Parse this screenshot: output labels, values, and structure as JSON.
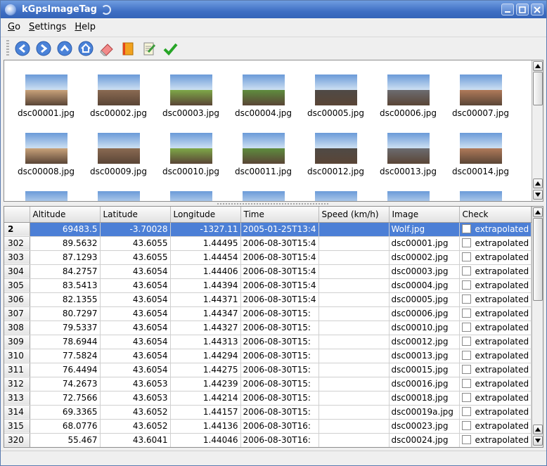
{
  "window": {
    "title": "kGpsImageTag",
    "colors": {
      "titlebar": "#3f6fc4",
      "selection": "#4c7fd6"
    }
  },
  "menu": [
    {
      "label": "Go"
    },
    {
      "label": "Settings"
    },
    {
      "label": "Help"
    }
  ],
  "toolbar": [
    {
      "icon": "back-arrow-icon"
    },
    {
      "icon": "forward-arrow-icon"
    },
    {
      "icon": "up-arrow-icon"
    },
    {
      "icon": "home-icon"
    },
    {
      "icon": "eraser-icon"
    },
    {
      "icon": "book-icon"
    },
    {
      "icon": "edit-document-icon"
    },
    {
      "icon": "checkmark-icon"
    }
  ],
  "thumbnails": [
    {
      "label": "dsc00001.jpg"
    },
    {
      "label": "dsc00002.jpg"
    },
    {
      "label": "dsc00003.jpg"
    },
    {
      "label": "dsc00004.jpg"
    },
    {
      "label": "dsc00005.jpg"
    },
    {
      "label": "dsc00006.jpg"
    },
    {
      "label": "dsc00007.jpg"
    },
    {
      "label": "dsc00008.jpg"
    },
    {
      "label": "dsc00009.jpg"
    },
    {
      "label": "dsc00010.jpg"
    },
    {
      "label": "dsc00011.jpg"
    },
    {
      "label": "dsc00012.jpg"
    },
    {
      "label": "dsc00013.jpg"
    },
    {
      "label": "dsc00014.jpg"
    }
  ],
  "table": {
    "columns": [
      "Altitude",
      "Latitude",
      "Longitude",
      "Time",
      "Speed (km/h)",
      "Image",
      "Check"
    ],
    "rows": [
      {
        "id": "2",
        "altitude": "69483.5",
        "latitude": "-3.70028",
        "longitude": "-1327.11",
        "time": "2005-01-25T13:4",
        "speed": "",
        "image": "Wolf.jpg",
        "check": "extrapolated",
        "selected": true
      },
      {
        "id": "302",
        "altitude": "89.5632",
        "latitude": "43.6055",
        "longitude": "1.44495",
        "time": "2006-08-30T15:4",
        "speed": "",
        "image": "dsc00001.jpg",
        "check": "extrapolated"
      },
      {
        "id": "303",
        "altitude": "87.1293",
        "latitude": "43.6055",
        "longitude": "1.44454",
        "time": "2006-08-30T15:4",
        "speed": "",
        "image": "dsc00002.jpg",
        "check": "extrapolated"
      },
      {
        "id": "304",
        "altitude": "84.2757",
        "latitude": "43.6054",
        "longitude": "1.44406",
        "time": "2006-08-30T15:4",
        "speed": "",
        "image": "dsc00003.jpg",
        "check": "extrapolated"
      },
      {
        "id": "305",
        "altitude": "83.5413",
        "latitude": "43.6054",
        "longitude": "1.44394",
        "time": "2006-08-30T15:4",
        "speed": "",
        "image": "dsc00004.jpg",
        "check": "extrapolated"
      },
      {
        "id": "306",
        "altitude": "82.1355",
        "latitude": "43.6054",
        "longitude": "1.44371",
        "time": "2006-08-30T15:4",
        "speed": "",
        "image": "dsc00005.jpg",
        "check": "extrapolated"
      },
      {
        "id": "307",
        "altitude": "80.7297",
        "latitude": "43.6054",
        "longitude": "1.44347",
        "time": "2006-08-30T15:",
        "speed": "",
        "image": "dsc00006.jpg",
        "check": "extrapolated"
      },
      {
        "id": "308",
        "altitude": "79.5337",
        "latitude": "43.6054",
        "longitude": "1.44327",
        "time": "2006-08-30T15:",
        "speed": "",
        "image": "dsc00010.jpg",
        "check": "extrapolated"
      },
      {
        "id": "309",
        "altitude": "78.6944",
        "latitude": "43.6054",
        "longitude": "1.44313",
        "time": "2006-08-30T15:",
        "speed": "",
        "image": "dsc00012.jpg",
        "check": "extrapolated"
      },
      {
        "id": "310",
        "altitude": "77.5824",
        "latitude": "43.6054",
        "longitude": "1.44294",
        "time": "2006-08-30T15:",
        "speed": "",
        "image": "dsc00013.jpg",
        "check": "extrapolated"
      },
      {
        "id": "311",
        "altitude": "76.4494",
        "latitude": "43.6054",
        "longitude": "1.44275",
        "time": "2006-08-30T15:",
        "speed": "",
        "image": "dsc00015.jpg",
        "check": "extrapolated"
      },
      {
        "id": "312",
        "altitude": "74.2673",
        "latitude": "43.6053",
        "longitude": "1.44239",
        "time": "2006-08-30T15:",
        "speed": "",
        "image": "dsc00016.jpg",
        "check": "extrapolated"
      },
      {
        "id": "313",
        "altitude": "72.7566",
        "latitude": "43.6053",
        "longitude": "1.44214",
        "time": "2006-08-30T15:",
        "speed": "",
        "image": "dsc00018.jpg",
        "check": "extrapolated"
      },
      {
        "id": "314",
        "altitude": "69.3365",
        "latitude": "43.6052",
        "longitude": "1.44157",
        "time": "2006-08-30T15:",
        "speed": "",
        "image": "dsc00019a.jpg",
        "check": "extrapolated"
      },
      {
        "id": "315",
        "altitude": "68.0776",
        "latitude": "43.6052",
        "longitude": "1.44136",
        "time": "2006-08-30T16:",
        "speed": "",
        "image": "dsc00023.jpg",
        "check": "extrapolated"
      },
      {
        "id": "320",
        "altitude": "55.467",
        "latitude": "43.6041",
        "longitude": "1.44046",
        "time": "2006-08-30T16:",
        "speed": "",
        "image": "dsc00024.jpg",
        "check": "extrapolated"
      }
    ]
  }
}
